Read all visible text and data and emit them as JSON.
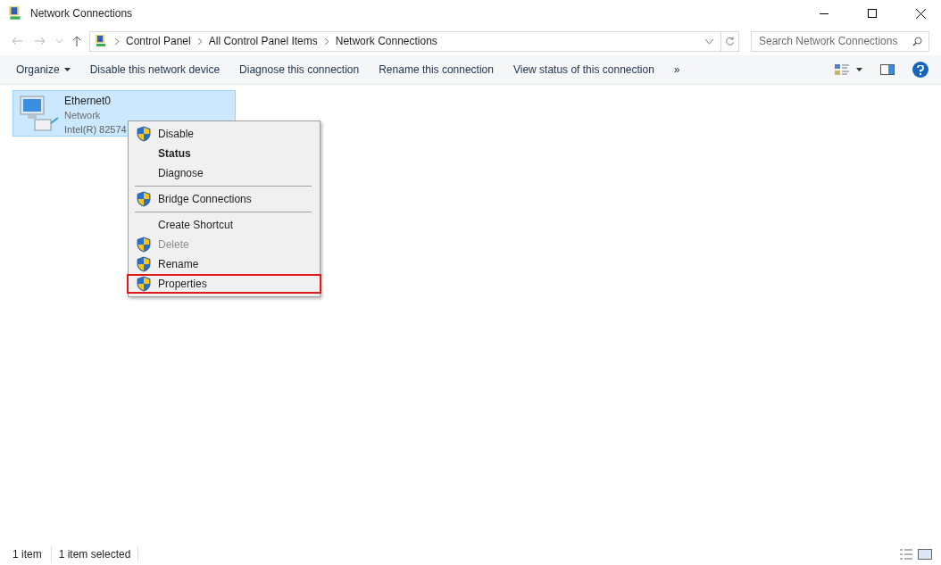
{
  "window": {
    "title": "Network Connections"
  },
  "breadcrumb": [
    "Control Panel",
    "All Control Panel Items",
    "Network Connections"
  ],
  "search": {
    "placeholder": "Search Network Connections"
  },
  "toolbar": [
    {
      "label": "Organize",
      "dropdown": true
    },
    {
      "label": "Disable this network device",
      "dropdown": false
    },
    {
      "label": "Diagnose this connection",
      "dropdown": false
    },
    {
      "label": "Rename this connection",
      "dropdown": false
    },
    {
      "label": "View status of this connection",
      "dropdown": false
    },
    {
      "label": "»",
      "dropdown": false
    }
  ],
  "connection": {
    "name": "Ethernet0",
    "status": "Network",
    "device": "Intel(R) 82574",
    "selected": true
  },
  "context_menu": [
    {
      "kind": "item",
      "label": "Disable",
      "shield": true,
      "bold": false,
      "disabled": false,
      "highlighted": false
    },
    {
      "kind": "item",
      "label": "Status",
      "shield": false,
      "bold": true,
      "disabled": false,
      "highlighted": false
    },
    {
      "kind": "item",
      "label": "Diagnose",
      "shield": false,
      "bold": false,
      "disabled": false,
      "highlighted": false
    },
    {
      "kind": "separator"
    },
    {
      "kind": "item",
      "label": "Bridge Connections",
      "shield": true,
      "bold": false,
      "disabled": false,
      "highlighted": false
    },
    {
      "kind": "separator"
    },
    {
      "kind": "item",
      "label": "Create Shortcut",
      "shield": false,
      "bold": false,
      "disabled": false,
      "highlighted": false
    },
    {
      "kind": "item",
      "label": "Delete",
      "shield": true,
      "bold": false,
      "disabled": true,
      "highlighted": false
    },
    {
      "kind": "item",
      "label": "Rename",
      "shield": true,
      "bold": false,
      "disabled": false,
      "highlighted": false
    },
    {
      "kind": "item",
      "label": "Properties",
      "shield": true,
      "bold": false,
      "disabled": false,
      "highlighted": true
    }
  ],
  "status_bar": [
    "1 item",
    "1 item selected"
  ]
}
